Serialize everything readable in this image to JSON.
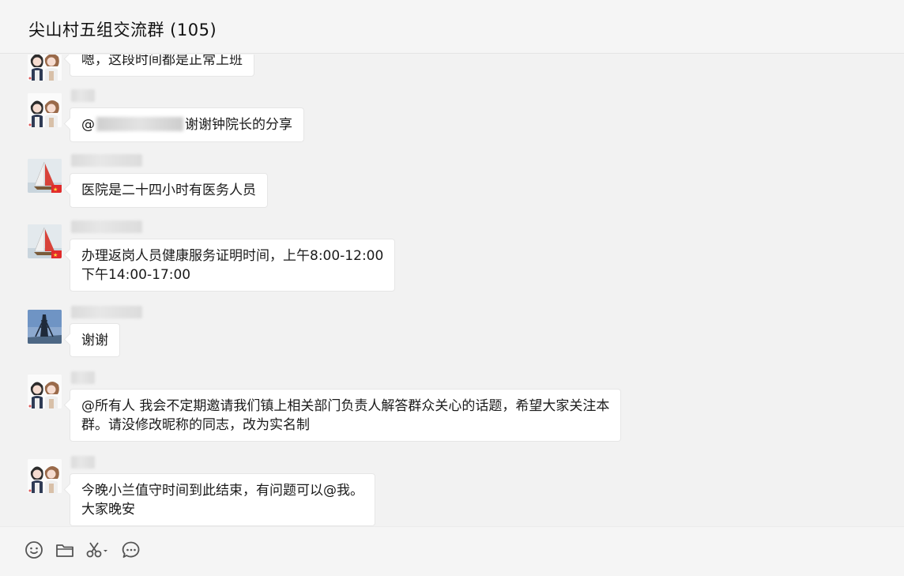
{
  "window": {
    "title": "尖山村五组交流群 (105)"
  },
  "messages": [
    {
      "avatar": "couple-cartoon-avatar",
      "text": "嗯，这段时间都是正常上班"
    },
    {
      "avatar": "couple-cartoon-avatar",
      "mention": "@",
      "text": "谢谢钟院长的分享"
    },
    {
      "avatar": "sailboat-avatar",
      "text": "医院是二十四小时有医务人员"
    },
    {
      "avatar": "sailboat-avatar",
      "line1": "办理返岗人员健康服务证明时间，上午8:00-12:00",
      "line2": "下午14:00-17:00"
    },
    {
      "avatar": "tower-landscape-avatar",
      "text": "谢谢"
    },
    {
      "avatar": "couple-cartoon-avatar",
      "line1": "@所有人 我会不定期邀请我们镇上相关部门负责人解答群众关心的话题，希望大家关注本",
      "line2": "群。请没修改昵称的同志，改为实名制"
    },
    {
      "avatar": "couple-cartoon-avatar",
      "line1": "今晚小兰值守时间到此结束，有问题可以@我。",
      "line2": "大家晚安"
    }
  ],
  "toolbar": {
    "icons": [
      "emoji-icon",
      "folder-icon",
      "scissors-icon",
      "chat-history-icon"
    ]
  },
  "colors": {
    "background": "#f2f2f2",
    "bubble": "#ffffff",
    "header": "#f5f5f5"
  }
}
